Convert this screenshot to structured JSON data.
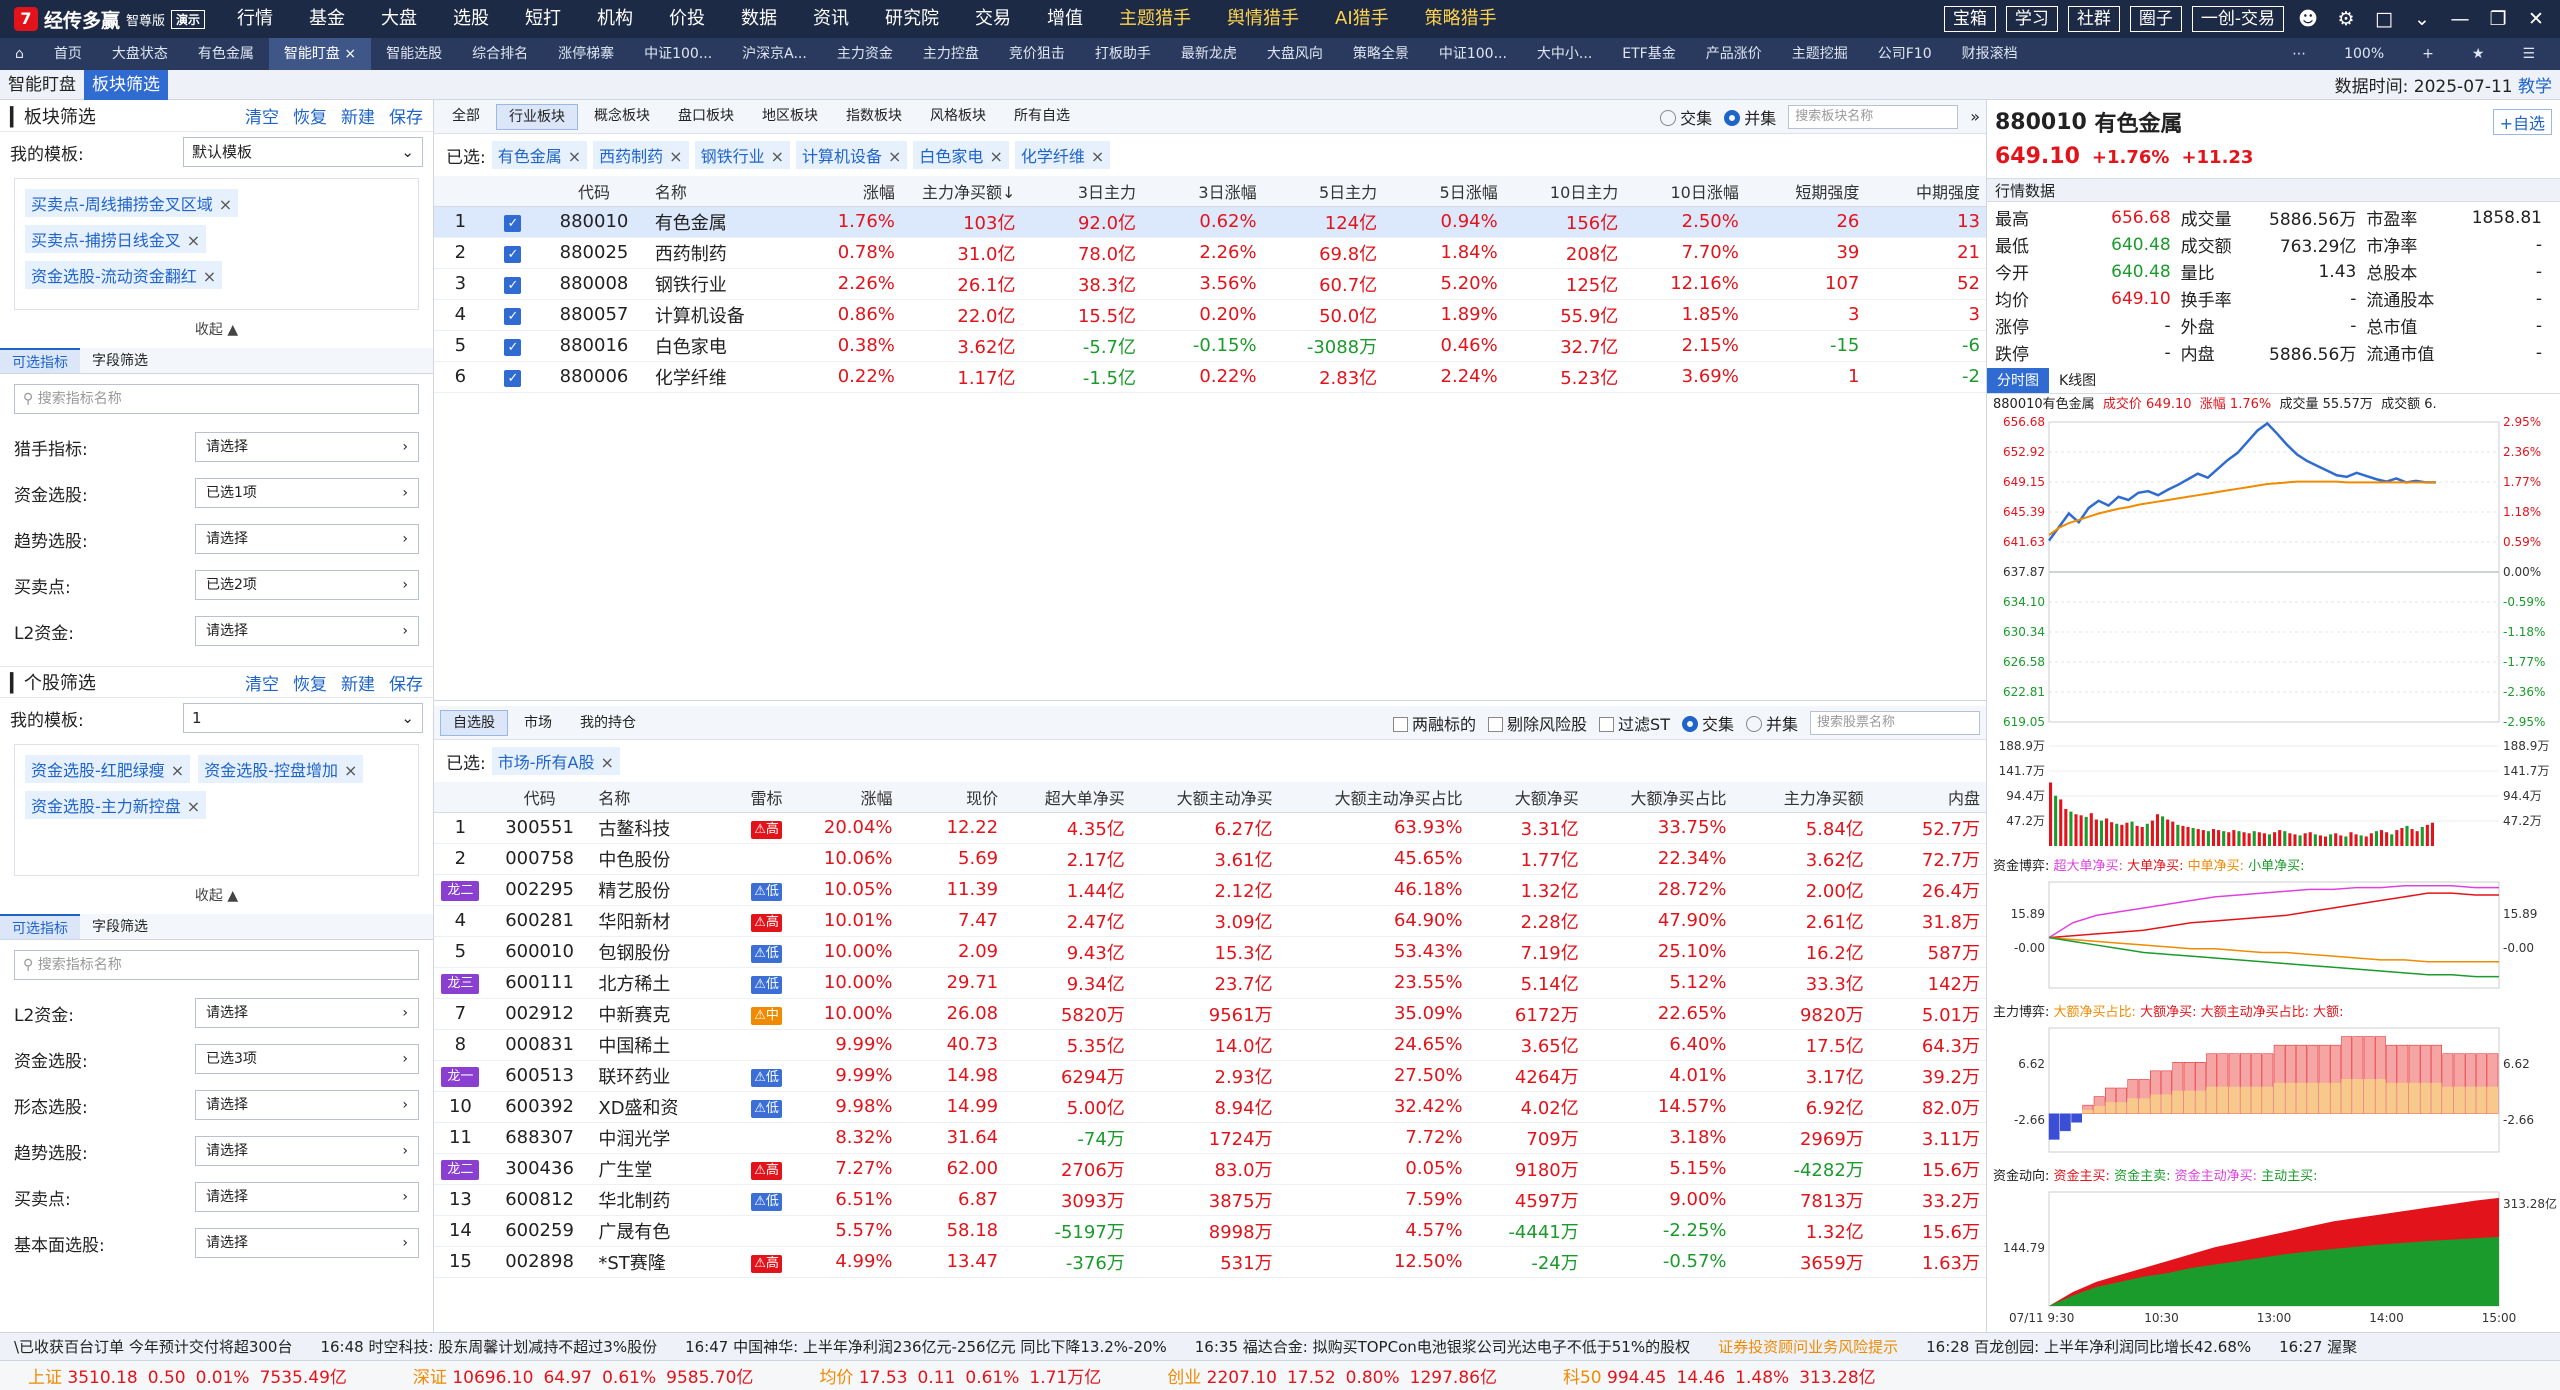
{
  "app": {
    "logo_mark": "7",
    "name": "经传多赢",
    "edition": "智尊版",
    "demo": "演示"
  },
  "menu": [
    "行情",
    "基金",
    "大盘",
    "选股",
    "短打",
    "机构",
    "价投",
    "数据",
    "资讯",
    "研究院",
    "交易",
    "增值",
    "主题猎手",
    "舆情猎手",
    "AI猎手",
    "策略猎手"
  ],
  "menu_highlight": [
    "主题猎手",
    "舆情猎手",
    "AI猎手",
    "策略猎手"
  ],
  "top_right": [
    "宝箱",
    "学习",
    "社群",
    "圈子",
    "一创-交易"
  ],
  "tabs": [
    "首页",
    "大盘状态",
    "有色金属",
    "智能盯盘",
    "智能选股",
    "综合排名",
    "涨停梯寨",
    "中证100...",
    "沪深京A...",
    "主力资金",
    "主力控盘",
    "竞价狙击",
    "打板助手",
    "最新龙虎",
    "大盘风向",
    "策略全景",
    "中证100...",
    "大中小...",
    "ETF基金",
    "产品涨价",
    "主题挖掘",
    "公司F10",
    "财报滚档"
  ],
  "active_tab": "智能盯盘",
  "zoom": "100%",
  "subtabs": [
    "智能盯盘",
    "板块筛选"
  ],
  "data_time_label": "数据时间:",
  "data_time": "2025-07-11",
  "teach": "教学",
  "sector_filter": {
    "title": "板块筛选",
    "actions": [
      "清空",
      "恢复",
      "新建",
      "保存"
    ],
    "template_label": "我的模板:",
    "template_value": "默认模板",
    "tags": [
      "买卖点-周线捕捞金叉区域",
      "买卖点-捕捞日线金叉",
      "资金选股-流动资金翻红"
    ],
    "collapse": "收起",
    "subtabs": [
      "可选指标",
      "字段筛选"
    ],
    "search_placeholder": "搜索指标名称",
    "criteria": [
      {
        "label": "猎手指标:",
        "value": "请选择"
      },
      {
        "label": "资金选股:",
        "value": "已选1项"
      },
      {
        "label": "趋势选股:",
        "value": "请选择"
      },
      {
        "label": "买卖点:",
        "value": "已选2项"
      },
      {
        "label": "L2资金:",
        "value": "请选择"
      }
    ]
  },
  "stock_filter": {
    "title": "个股筛选",
    "actions": [
      "清空",
      "恢复",
      "新建",
      "保存"
    ],
    "template_label": "我的模板:",
    "template_value": "1",
    "tags": [
      "资金选股-红肥绿瘦",
      "资金选股-控盘增加",
      "资金选股-主力新控盘"
    ],
    "collapse": "收起",
    "subtabs": [
      "可选指标",
      "字段筛选"
    ],
    "search_placeholder": "搜索指标名称",
    "criteria": [
      {
        "label": "L2资金:",
        "value": "请选择"
      },
      {
        "label": "资金选股:",
        "value": "已选3项"
      },
      {
        "label": "形态选股:",
        "value": "请选择"
      },
      {
        "label": "趋势选股:",
        "value": "请选择"
      },
      {
        "label": "买卖点:",
        "value": "请选择"
      },
      {
        "label": "基本面选股:",
        "value": "请选择"
      }
    ]
  },
  "sector_tabs": [
    "全部",
    "行业板块",
    "概念板块",
    "盘口板块",
    "地区板块",
    "指数板块",
    "风格板块",
    "所有自选"
  ],
  "sector_active": "行业板块",
  "mode_labels": [
    "交集",
    "并集"
  ],
  "sector_search_placeholder": "搜索板块名称",
  "chosen_label": "已选:",
  "sector_chosen": [
    "有色金属",
    "西药制药",
    "钢铁行业",
    "计算机设备",
    "白色家电",
    "化学纤维"
  ],
  "sector_table": {
    "headers": [
      "",
      "",
      "代码",
      "名称",
      "涨幅",
      "主力净买额↓",
      "3日主力",
      "3日涨幅",
      "5日主力",
      "5日涨幅",
      "10日主力",
      "10日涨幅",
      "短期强度",
      "中期强度"
    ],
    "rows": [
      [
        "1",
        "880010",
        "有色金属",
        "1.76%",
        "103亿",
        "92.0亿",
        "0.62%",
        "124亿",
        "0.94%",
        "156亿",
        "2.50%",
        "26",
        "13"
      ],
      [
        "2",
        "880025",
        "西药制药",
        "0.78%",
        "31.0亿",
        "78.0亿",
        "2.26%",
        "69.8亿",
        "1.84%",
        "208亿",
        "7.70%",
        "39",
        "21"
      ],
      [
        "3",
        "880008",
        "钢铁行业",
        "2.26%",
        "26.1亿",
        "38.3亿",
        "3.56%",
        "60.7亿",
        "5.20%",
        "125亿",
        "12.16%",
        "107",
        "52"
      ],
      [
        "4",
        "880057",
        "计算机设备",
        "0.86%",
        "22.0亿",
        "15.5亿",
        "0.20%",
        "50.0亿",
        "1.89%",
        "55.9亿",
        "1.85%",
        "3",
        "3"
      ],
      [
        "5",
        "880016",
        "白色家电",
        "0.38%",
        "3.62亿",
        "-5.7亿",
        "-0.15%",
        "-3088万",
        "0.46%",
        "32.7亿",
        "2.15%",
        "-15",
        "-6"
      ],
      [
        "6",
        "880006",
        "化学纤维",
        "0.22%",
        "1.17亿",
        "-1.5亿",
        "0.22%",
        "2.83亿",
        "2.24%",
        "5.23亿",
        "3.69%",
        "1",
        "-2"
      ]
    ]
  },
  "stock_tabs": [
    "自选股",
    "市场",
    "我的持仓"
  ],
  "stock_options": [
    "两融标的",
    "剔除风险股",
    "过滤ST"
  ],
  "stock_search_placeholder": "搜索股票名称",
  "stock_chosen": [
    "市场-所有A股"
  ],
  "stock_table": {
    "headers": [
      "",
      "代码",
      "名称",
      "雷标",
      "涨幅",
      "现价",
      "超大单净买",
      "大额主动净买",
      "大额主动净买占比",
      "大额净买",
      "大额净买占比",
      "主力净买额",
      "内盘"
    ],
    "rows": [
      [
        "1",
        "",
        "300551",
        "古鳌科技",
        "高",
        "20.04%",
        "12.22",
        "4.35亿",
        "6.27亿",
        "63.93%",
        "3.31亿",
        "33.75%",
        "5.84亿",
        "52.7万"
      ],
      [
        "2",
        "",
        "000758",
        "中色股份",
        "",
        "10.06%",
        "5.69",
        "2.17亿",
        "3.61亿",
        "45.65%",
        "1.77亿",
        "22.34%",
        "3.62亿",
        "72.7万"
      ],
      [
        "",
        "龙二",
        "002295",
        "精艺股份",
        "低",
        "10.05%",
        "11.39",
        "1.44亿",
        "2.12亿",
        "46.18%",
        "1.32亿",
        "28.72%",
        "2.00亿",
        "26.4万"
      ],
      [
        "4",
        "",
        "600281",
        "华阳新材",
        "高",
        "10.01%",
        "7.47",
        "2.47亿",
        "3.09亿",
        "64.90%",
        "2.28亿",
        "47.90%",
        "2.61亿",
        "31.8万"
      ],
      [
        "5",
        "",
        "600010",
        "包钢股份",
        "低",
        "10.00%",
        "2.09",
        "9.43亿",
        "15.3亿",
        "53.43%",
        "7.19亿",
        "25.10%",
        "16.2亿",
        "587万"
      ],
      [
        "",
        "龙三",
        "600111",
        "北方稀土",
        "低",
        "10.00%",
        "29.71",
        "9.34亿",
        "23.7亿",
        "23.55%",
        "5.14亿",
        "5.12%",
        "33.3亿",
        "142万"
      ],
      [
        "7",
        "",
        "002912",
        "中新赛克",
        "中",
        "10.00%",
        "26.08",
        "5820万",
        "9561万",
        "35.09%",
        "6172万",
        "22.65%",
        "9820万",
        "5.01万"
      ],
      [
        "8",
        "",
        "000831",
        "中国稀土",
        "",
        "9.99%",
        "40.73",
        "5.35亿",
        "14.0亿",
        "24.65%",
        "3.65亿",
        "6.40%",
        "17.5亿",
        "64.3万"
      ],
      [
        "",
        "龙一",
        "600513",
        "联环药业",
        "低",
        "9.99%",
        "14.98",
        "6294万",
        "2.93亿",
        "27.50%",
        "4264万",
        "4.01%",
        "3.17亿",
        "39.2万"
      ],
      [
        "10",
        "",
        "600392",
        "XD盛和资",
        "低",
        "9.98%",
        "14.99",
        "5.00亿",
        "8.94亿",
        "32.42%",
        "4.02亿",
        "14.57%",
        "6.92亿",
        "82.0万"
      ],
      [
        "11",
        "",
        "688307",
        "中润光学",
        "",
        "8.32%",
        "31.64",
        "-74万",
        "1724万",
        "7.72%",
        "709万",
        "3.18%",
        "2969万",
        "3.11万"
      ],
      [
        "",
        "龙二",
        "300436",
        "广生堂",
        "高",
        "7.27%",
        "62.00",
        "2706万",
        "83.0万",
        "0.05%",
        "9180万",
        "5.15%",
        "-4282万",
        "15.6万"
      ],
      [
        "13",
        "",
        "600812",
        "华北制药",
        "低",
        "6.51%",
        "6.87",
        "3093万",
        "3875万",
        "7.59%",
        "4597万",
        "9.00%",
        "7813万",
        "33.2万"
      ],
      [
        "14",
        "",
        "600259",
        "广晟有色",
        "",
        "5.57%",
        "58.18",
        "-5197万",
        "8998万",
        "4.57%",
        "-4441万",
        "-2.25%",
        "1.32亿",
        "15.6万"
      ],
      [
        "15",
        "",
        "002898",
        "*ST赛隆",
        "高",
        "4.99%",
        "13.47",
        "-376万",
        "531万",
        "12.50%",
        "-24万",
        "-0.57%",
        "3659万",
        "1.63万"
      ]
    ]
  },
  "quote": {
    "code": "880010",
    "name": "有色金属",
    "price": "649.10",
    "pct": "+1.76%",
    "chg": "+11.23",
    "add": "+自选",
    "section": "行情数据",
    "fields": [
      [
        "最高",
        "656.68",
        "成交量",
        "5886.56万",
        "市盈率",
        "1858.81"
      ],
      [
        "最低",
        "640.48",
        "成交额",
        "763.29亿",
        "市净率",
        "-"
      ],
      [
        "今开",
        "640.48",
        "量比",
        "1.43",
        "总股本",
        "-"
      ],
      [
        "均价",
        "649.10",
        "换手率",
        "-",
        "流通股本",
        "-"
      ],
      [
        "涨停",
        "-",
        "外盘",
        "-",
        "总市值",
        "-"
      ],
      [
        "跌停",
        "-",
        "内盘",
        "5886.56万",
        "流通市值",
        "-"
      ]
    ]
  },
  "chart_tabs": [
    "分时图",
    "K线图"
  ],
  "intraday_title": {
    "name": "880010有色金属",
    "price": "成交价 649.10",
    "pct": "涨幅 1.76%",
    "vol": "成交量 55.57万",
    "vol2": "成交额 6."
  },
  "panel_titles": {
    "fund": "资金博弈",
    "fund_items": [
      "超大单净买:",
      "大单净买:",
      "中单净买:",
      "小单净买:"
    ],
    "main": "主力博弈",
    "main_items": [
      "大额净买占比:",
      "大额净买:",
      "大额主动净买占比:",
      "大额:"
    ],
    "flow": "资金动向",
    "flow_items": [
      "资金主买:",
      "资金主卖:",
      "资金主动净买:",
      "主动主买:"
    ]
  },
  "chart_data": [
    {
      "type": "line",
      "title": "",
      "series": [
        {
          "name": "成交价",
          "values": [
            641.8,
            643.5,
            645.2,
            644.1,
            645.9,
            646.8,
            646.2,
            647.3,
            646.9,
            647.8,
            648.0,
            647.5,
            648.2,
            648.8,
            649.5,
            650.2,
            649.7,
            650.8,
            651.9,
            652.8,
            654.2,
            655.6,
            656.5,
            655.2,
            653.8,
            652.6,
            651.8,
            651.2,
            650.6,
            650.0,
            649.8,
            650.3,
            649.9,
            649.5,
            649.2,
            649.6,
            649.1,
            649.3,
            649.1,
            649.1
          ]
        },
        {
          "name": "均价",
          "values": [
            642.5,
            643.4,
            644.0,
            644.4,
            644.8,
            645.2,
            645.5,
            645.8,
            646.0,
            646.3,
            646.5,
            646.7,
            646.9,
            647.1,
            647.3,
            647.5,
            647.7,
            647.9,
            648.1,
            648.3,
            648.5,
            648.7,
            648.9,
            649.0,
            649.1,
            649.2,
            649.2,
            649.2,
            649.2,
            649.2,
            649.1,
            649.1,
            649.1,
            649.1,
            649.1,
            649.1,
            649.1,
            649.1,
            649.1,
            649.1
          ]
        }
      ],
      "y_ticks_left": [
        "656.68",
        "652.92",
        "649.15",
        "645.39",
        "641.63",
        "637.87",
        "634.10",
        "630.34",
        "626.58",
        "622.81",
        "619.05"
      ],
      "y_ticks_right": [
        "2.95%",
        "2.36%",
        "1.77%",
        "1.18%",
        "0.59%",
        "0.00%",
        "-0.59%",
        "-1.18%",
        "-1.77%",
        "-2.36%",
        "-2.95%"
      ],
      "ylim": [
        619.05,
        656.68
      ]
    },
    {
      "type": "bar",
      "title": "",
      "ylabel_ticks": [
        "188.9万",
        "141.7万",
        "94.4万",
        "47.2万"
      ],
      "values": [
        120,
        95,
        88,
        70,
        65,
        60,
        58,
        55,
        62,
        50,
        48,
        52,
        45,
        42,
        40,
        44,
        46,
        38,
        36,
        42,
        48,
        60,
        56,
        50,
        46,
        40,
        38,
        36,
        34,
        32,
        30,
        28,
        32,
        30,
        28,
        26,
        30,
        28,
        26,
        24,
        28,
        26,
        24,
        22,
        26,
        30,
        28,
        24,
        22,
        20,
        24,
        26,
        22,
        20,
        18,
        22,
        24,
        20,
        18,
        26,
        22,
        20,
        18,
        24,
        28,
        30,
        26,
        22,
        30,
        34,
        38,
        32,
        28,
        36,
        40,
        44
      ],
      "ylim": [
        0,
        188.9
      ]
    },
    {
      "type": "line",
      "title": "资金博弈",
      "y_ticks": [
        "15.89",
        "-0.00"
      ],
      "series": [
        {
          "name": "超大单净买",
          "values": [
            0,
            8,
            12,
            14,
            16,
            18,
            20,
            22,
            23,
            24,
            25,
            26,
            26,
            27,
            27,
            28,
            28,
            28,
            27,
            27
          ]
        },
        {
          "name": "大单净买",
          "values": [
            0,
            1,
            2,
            3,
            4,
            6,
            8,
            9,
            10,
            11,
            12,
            14,
            16,
            18,
            20,
            22,
            24,
            24,
            23,
            23
          ]
        },
        {
          "name": "中单净买",
          "values": [
            0,
            -1,
            -2,
            -3,
            -4,
            -5,
            -6,
            -6,
            -7,
            -8,
            -8,
            -9,
            -10,
            -11,
            -12,
            -12,
            -13,
            -13,
            -13,
            -13
          ]
        },
        {
          "name": "小单净买",
          "values": [
            0,
            -2,
            -4,
            -6,
            -8,
            -9,
            -10,
            -11,
            -12,
            -13,
            -14,
            -15,
            -16,
            -17,
            -18,
            -19,
            -20,
            -20,
            -21,
            -21
          ]
        }
      ],
      "ylim": [
        -25,
        30
      ]
    },
    {
      "type": "bar",
      "title": "主力博弈",
      "y_ticks": [
        "6.62",
        "-2.66"
      ],
      "values": [
        -3,
        -2,
        -1,
        1,
        2,
        3,
        3,
        4,
        4,
        5,
        5,
        6,
        6,
        6,
        7,
        7,
        7,
        7,
        7,
        7,
        8,
        8,
        8,
        8,
        8,
        8,
        9,
        9,
        9,
        9,
        8,
        8,
        8,
        8,
        8,
        7,
        7,
        7,
        7,
        7
      ],
      "ylim": [
        -4,
        10
      ]
    },
    {
      "type": "area",
      "title": "资金动向",
      "y_ticks": [
        "313.28亿",
        "144.79"
      ],
      "series": [
        {
          "name": "资金主买",
          "values": [
            0,
            40,
            70,
            90,
            110,
            130,
            150,
            170,
            185,
            200,
            215,
            230,
            245,
            255,
            265,
            275,
            285,
            295,
            305,
            313
          ]
        },
        {
          "name": "资金主卖",
          "values": [
            0,
            30,
            55,
            70,
            85,
            95,
            110,
            120,
            130,
            140,
            150,
            158,
            165,
            172,
            178,
            183,
            188,
            192,
            196,
            200
          ]
        }
      ],
      "ylim": [
        0,
        330
      ],
      "x_ticks": [
        "07/11 9:30",
        "10:30",
        "13:00",
        "14:00",
        "15:00"
      ]
    }
  ],
  "ticker": [
    "\\已收获百台订单 今年预计交付将超300台",
    "16:48 时空科技: 股东周馨计划减持不超过3%股份",
    "16:47 中国神华: 上半年净利润236亿元-256亿元 同比下降13.2%-20%",
    "16:35 福达合金: 拟购买TOPCon电池银浆公司光达电子不低于51%的股权",
    "证券投资顾问业务风险提示",
    "16:28 百龙创园: 上半年净利润同比增长42.68%",
    "16:27 渥聚"
  ],
  "status": [
    {
      "n": "上证",
      "v": "3510.18",
      "c": "0.50",
      "p": "0.01%",
      "a": "7535.49亿"
    },
    {
      "n": "深证",
      "v": "10696.10",
      "c": "64.97",
      "p": "0.61%",
      "a": "9585.70亿"
    },
    {
      "n": "均价",
      "v": "17.53",
      "c": "0.11",
      "p": "0.61%",
      "a": "1.71万亿"
    },
    {
      "n": "创业",
      "v": "2207.10",
      "c": "17.52",
      "p": "0.80%",
      "a": "1297.86亿"
    },
    {
      "n": "科50",
      "v": "994.45",
      "c": "14.46",
      "p": "1.48%",
      "a": "313.28亿"
    }
  ],
  "colors": {
    "up": "#e3131b",
    "down": "#1a9b2b",
    "accent": "#2f6bd1",
    "price_line": "#2f6bd1",
    "avg_line": "#f08a00"
  }
}
